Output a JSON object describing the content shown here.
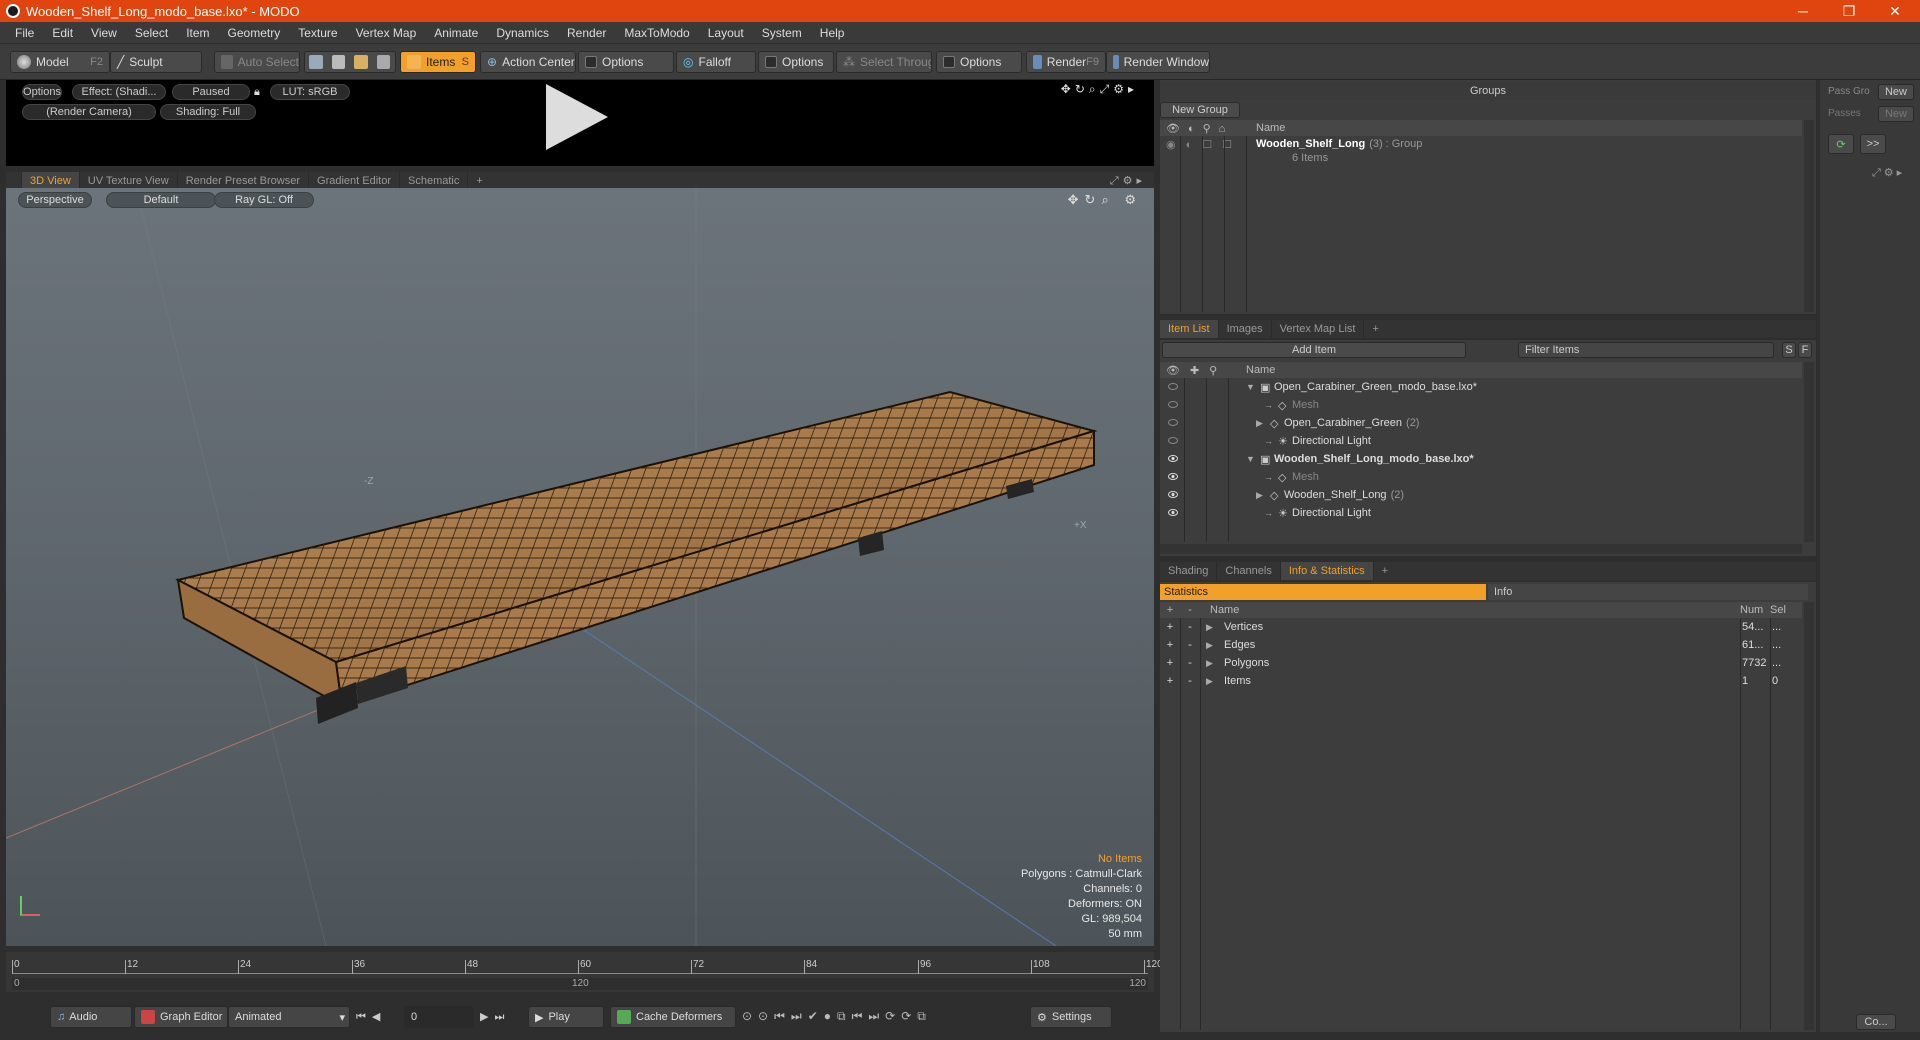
{
  "window": {
    "title": "Wooden_Shelf_Long_modo_base.lxo* - MODO",
    "minimize": "─",
    "maximize": "❐",
    "close": "✕"
  },
  "menu": [
    "File",
    "Edit",
    "View",
    "Select",
    "Item",
    "Geometry",
    "Texture",
    "Vertex Map",
    "Animate",
    "Dynamics",
    "Render",
    "MaxToModo",
    "Layout",
    "System",
    "Help"
  ],
  "toolbar": {
    "model": "Model",
    "model_key": "F2",
    "sculpt": "Sculpt",
    "auto_select": "Auto Select",
    "items": "Items",
    "items_key": "S",
    "action_center": "Action Center",
    "options1": "Options",
    "falloff": "Falloff",
    "options2": "Options",
    "select_through": "Select Through",
    "options3": "Options",
    "render": "Render",
    "render_key": "F9",
    "render_window": "Render Window"
  },
  "preview": {
    "options": "Options",
    "effect": "Effect: (Shadi...",
    "paused": "Paused",
    "lut": "LUT: sRGB",
    "camera": "(Render Camera)",
    "shading": "Shading: Full"
  },
  "viewport_tabs": [
    "3D View",
    "UV Texture View",
    "Render Preset Browser",
    "Gradient Editor",
    "Schematic",
    "+"
  ],
  "viewport": {
    "perspective": "Perspective",
    "default": "Default",
    "raygl": "Ray GL: Off",
    "axis_z": "-Z",
    "axis_x": "+X",
    "hud": {
      "no_items": "No Items",
      "polygons": "Polygons : Catmull-Clark",
      "channels": "Channels: 0",
      "deformers": "Deformers: ON",
      "gl": "GL: 989,504",
      "unit": "50 mm"
    }
  },
  "timeline": {
    "ticks": [
      "0",
      "12",
      "24",
      "36",
      "48",
      "60",
      "72",
      "84",
      "96",
      "108",
      "120"
    ],
    "sub_start": "0",
    "sub_mid": "120",
    "sub_end": "120"
  },
  "bottombar": {
    "audio": "Audio",
    "graph_editor": "Graph Editor",
    "animated": "Animated",
    "frame": "0",
    "play": "Play",
    "cache": "Cache Deformers",
    "settings": "Settings"
  },
  "groups": {
    "title": "Groups",
    "new_group": "New Group",
    "col_name": "Name",
    "row_name": "Wooden_Shelf_Long",
    "row_count": "(3)",
    "row_type": ": Group",
    "row_sub": "6 Items"
  },
  "pass": {
    "pass_label": "Pass Gro",
    "new1": "New",
    "passes_label": "Passes",
    "new2": "New",
    "more": ">>"
  },
  "itemlist": {
    "tabs": [
      "Item List",
      "Images",
      "Vertex Map List",
      "+"
    ],
    "add_item": "Add Item",
    "filter": "Filter Items",
    "s": "S",
    "f": "F",
    "col_name": "Name",
    "rows": [
      {
        "label": "Open_Carabiner_Green_modo_base.lxo*",
        "bold": false
      },
      {
        "label": "Mesh",
        "dim": true
      },
      {
        "label": "Open_Carabiner_Green",
        "count": "(2)"
      },
      {
        "label": "Directional Light"
      },
      {
        "label": "Wooden_Shelf_Long_modo_base.lxo*",
        "bold": true
      },
      {
        "label": "Mesh",
        "dim": true
      },
      {
        "label": "Wooden_Shelf_Long",
        "count": "(2)"
      },
      {
        "label": "Directional Light"
      }
    ]
  },
  "stats": {
    "tabs": [
      "Shading",
      "Channels",
      "Info & Statistics",
      "+"
    ],
    "statistics": "Statistics",
    "info": "Info",
    "col_plus": "+",
    "col_minus": "-",
    "col_name": "Name",
    "col_num": "Num",
    "col_sel": "Sel",
    "rows": [
      {
        "name": "Vertices",
        "num": "54...",
        "sel": "..."
      },
      {
        "name": "Edges",
        "num": "61...",
        "sel": "..."
      },
      {
        "name": "Polygons",
        "num": "7732",
        "sel": "..."
      },
      {
        "name": "Items",
        "num": "1",
        "sel": "0"
      }
    ]
  },
  "rightstrip": {
    "co": "Co..."
  },
  "colors": {
    "accent": "#f2a02a",
    "titlebar": "#e0450f"
  }
}
